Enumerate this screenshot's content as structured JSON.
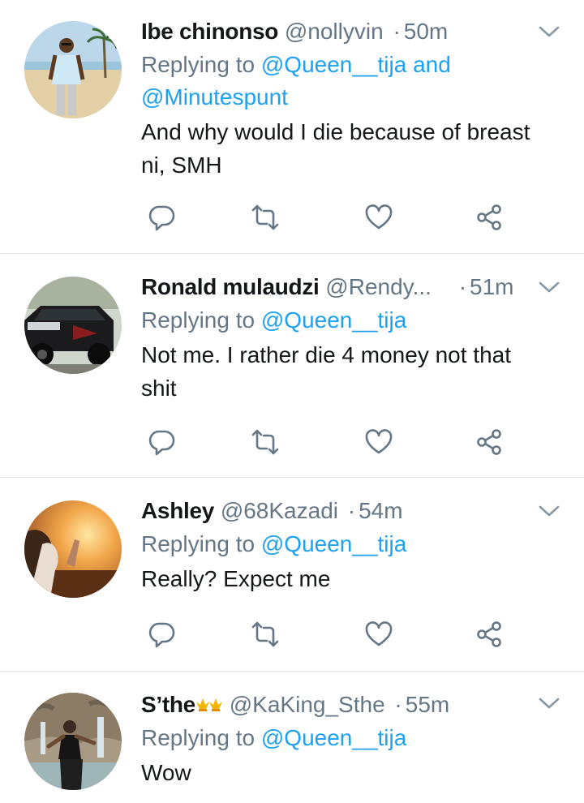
{
  "colors": {
    "link": "#1da1f2",
    "secondary": "#657786",
    "primary_text": "#14171a",
    "divider": "#e1e8ed"
  },
  "tweets": [
    {
      "name": "Ibe chinonso",
      "handle": "@nollyvin",
      "separator": "·",
      "time": "50m",
      "replying_prefix": "Replying to",
      "mention_1": "@Queen__tija",
      "conjunction": "and",
      "mention_2": "@Minutespunt",
      "text_line_1": "And why would I die because of breast",
      "text_line_2": "ni, SMH",
      "avatar": "man-on-beach-avatar"
    },
    {
      "name": "Ronald mulaudzi",
      "handle": "@Rendy...",
      "separator": "·",
      "time": "51m",
      "replying_prefix": "Replying to",
      "mention_1": "@Queen__tija",
      "text_line_1": "Not me. I rather die 4 money not that",
      "text_line_2": "shit",
      "avatar": "black-car-avatar"
    },
    {
      "name": "Ashley",
      "handle": "@68Kazadi",
      "separator": "·",
      "time": "54m",
      "replying_prefix": "Replying to",
      "mention_1": "@Queen__tija",
      "text_line_1": "Really? Expect me",
      "avatar": "sunset-woman-avatar"
    },
    {
      "name": "S’the",
      "name_emoji": "crown-emojis",
      "handle": "@KaKing_Sthe",
      "separator": "·",
      "time": "55m",
      "replying_prefix": "Replying to",
      "mention_1": "@Queen__tija",
      "text_line_1": "Wow",
      "avatar": "woman-waterfall-avatar"
    }
  ],
  "icons": {
    "reply": "reply-icon",
    "retweet": "retweet-icon",
    "like": "like-icon",
    "share": "share-icon",
    "menu": "chevron-down-icon"
  }
}
